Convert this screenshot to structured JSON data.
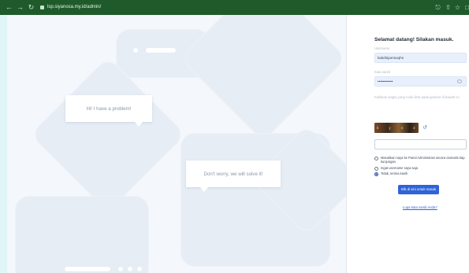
{
  "browser": {
    "url": "lsp.siyanosa.my.id/admin/",
    "back_icon": "arrow-left",
    "forward_icon": "arrow-right",
    "reload_icon": "reload",
    "actions": [
      "key-icon",
      "share-icon",
      "star-icon",
      "window-icon"
    ]
  },
  "stage": {
    "bubble_1": "Hi! I have a problem!",
    "bubble_2": "Don't worry, we will solve it!"
  },
  "login": {
    "welcome": "Selamat datang! Silakan masuk.",
    "username_label": "Username",
    "username_value": "kakdinjamsoqhn",
    "password_label": "Kata sandi",
    "password_value": "••••••••••••",
    "captcha_label": "Ketikkan angka yang Anda lihat pada gambar di bawah ini.",
    "captcha_text": "b y 4 2 p",
    "options": [
      {
        "label": "Masukkan saya ke Panel Administrasi secara otomatis tiap kunjungan",
        "checked": false
      },
      {
        "label": "Ingat username saya saja",
        "checked": false
      },
      {
        "label": "Tidak, terima kasih",
        "checked": true
      }
    ],
    "submit_label": "Klik di sini untuk masuk",
    "forgot_label": "Lupa kata sandi Anda?"
  },
  "colors": {
    "browser_bar": "#1f5b2a",
    "accent": "#2f63d9",
    "field_fill": "#e8f0fe",
    "stage_bg": "#f4f7fb"
  }
}
